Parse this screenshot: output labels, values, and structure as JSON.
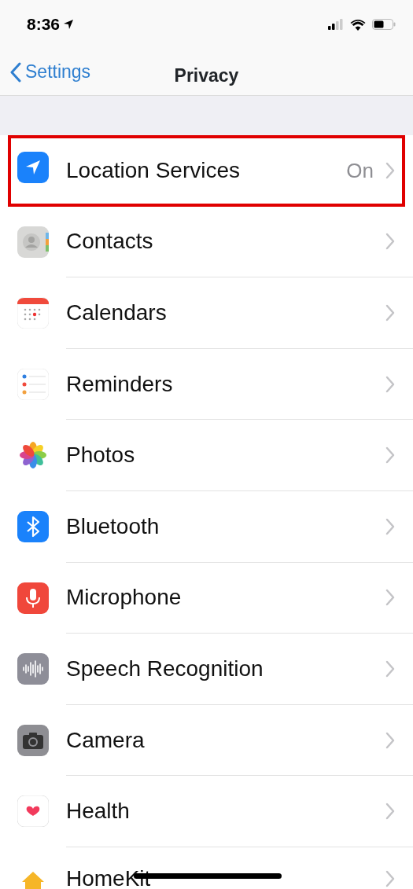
{
  "status_bar": {
    "time": "8:36"
  },
  "nav": {
    "back": "Settings",
    "title": "Privacy"
  },
  "rows": [
    {
      "label": "Location Services",
      "value": "On",
      "highlighted": true
    },
    {
      "label": "Contacts",
      "highlighted": false
    },
    {
      "label": "Calendars",
      "highlighted": false
    },
    {
      "label": "Reminders",
      "highlighted": false
    },
    {
      "label": "Photos",
      "highlighted": false
    },
    {
      "label": "Bluetooth",
      "highlighted": false
    },
    {
      "label": "Microphone",
      "highlighted": false
    },
    {
      "label": "Speech Recognition",
      "highlighted": false
    },
    {
      "label": "Camera",
      "highlighted": false
    },
    {
      "label": "Health",
      "highlighted": false
    },
    {
      "label": "HomeKit",
      "highlighted": false
    }
  ]
}
